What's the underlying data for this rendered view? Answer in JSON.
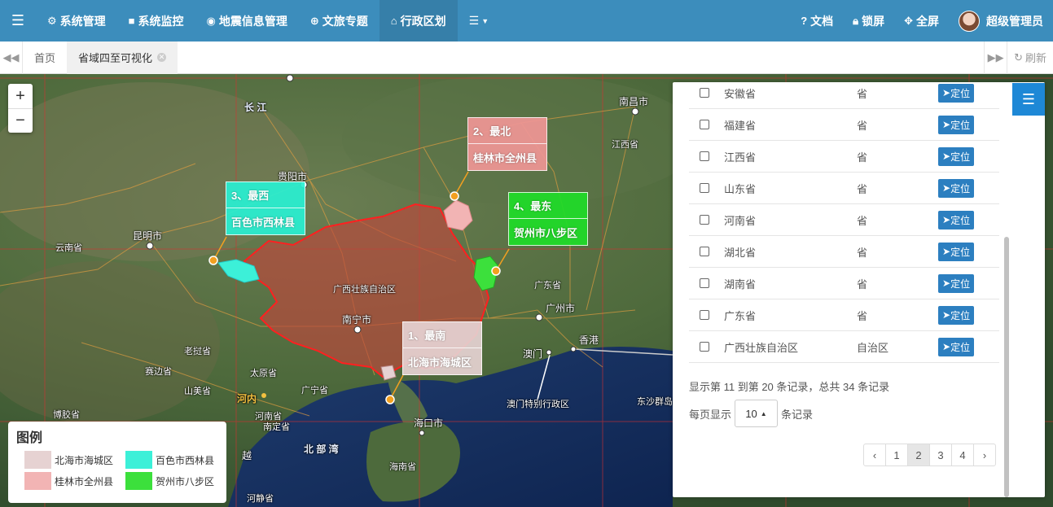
{
  "nav": {
    "items": [
      {
        "label": "系统管理",
        "icon": "gear-icon"
      },
      {
        "label": "系统监控",
        "icon": "video-icon"
      },
      {
        "label": "地震信息管理",
        "icon": "map-pin-icon"
      },
      {
        "label": "文旅专题",
        "icon": "globe-icon"
      },
      {
        "label": "行政区划",
        "icon": "bank-icon"
      }
    ],
    "active_index": 4,
    "right": {
      "docs": "文档",
      "lock": "锁屏",
      "fullscreen": "全屏",
      "user": "超级管理员"
    }
  },
  "tabs": {
    "home": "首页",
    "current": "省域四至可视化",
    "refresh": "刷新"
  },
  "map": {
    "callouts": {
      "south": {
        "title": "1、最南",
        "place": "北海市海城区",
        "color": "#e6d2d2"
      },
      "north": {
        "title": "2、最北",
        "place": "桂林市全州县",
        "color": "#f09696"
      },
      "west": {
        "title": "3、最西",
        "place": "百色市西林县",
        "color": "#28f0d2"
      },
      "east": {
        "title": "4、最东",
        "place": "贺州市八步区",
        "color": "#1edc28"
      }
    },
    "labels": {
      "region": "广西壮族自治区",
      "nanning": "南宁市",
      "kunming": "昆明市",
      "guiyang": "贵阳市",
      "nanchang": "南昌市",
      "guangzhou": "广州市",
      "hongkong": "香港",
      "macau": "澳门",
      "macau_sar": "澳门特别行政区",
      "haikou": "海口市",
      "yunnan": "云南省",
      "laos": "老挝省",
      "saiwan": "赛边省",
      "taiyuan": "太原省",
      "guangning": "广宁省",
      "shanmei": "山美省",
      "henei": "河内",
      "henan_vn": "河南省",
      "nanding": "南定省",
      "hainan": "海南省",
      "guangdong": "广东省",
      "jiangxi": "江西省",
      "beibu": "北 部 湾",
      "yue": "越",
      "hejiao": "河静省",
      "bojiao": "博胶省",
      "dongsha": "东沙群岛",
      "changjiang": "长  江"
    },
    "legend": {
      "title": "图例",
      "items": [
        {
          "label": "北海市海城区",
          "color": "#e6d2d2"
        },
        {
          "label": "百色市西林县",
          "color": "#3cf0d8"
        },
        {
          "label": "桂林市全州县",
          "color": "#f2b4b4"
        },
        {
          "label": "贺州市八步区",
          "color": "#3ce03c"
        }
      ]
    }
  },
  "panel": {
    "rows": [
      {
        "name": "安徽省",
        "level": "省",
        "action": "定位"
      },
      {
        "name": "福建省",
        "level": "省",
        "action": "定位"
      },
      {
        "name": "江西省",
        "level": "省",
        "action": "定位"
      },
      {
        "name": "山东省",
        "level": "省",
        "action": "定位"
      },
      {
        "name": "河南省",
        "level": "省",
        "action": "定位"
      },
      {
        "name": "湖北省",
        "level": "省",
        "action": "定位"
      },
      {
        "name": "湖南省",
        "level": "省",
        "action": "定位"
      },
      {
        "name": "广东省",
        "level": "省",
        "action": "定位"
      },
      {
        "name": "广西壮族自治区",
        "level": "自治区",
        "action": "定位"
      }
    ],
    "summary": "显示第 11 到第 20 条记录，总共 34 条记录",
    "page_size_prefix": "每页显示",
    "page_size": "10",
    "page_size_suffix": "条记录",
    "pager": [
      "‹",
      "1",
      "2",
      "3",
      "4",
      "›"
    ],
    "current_page": "2"
  }
}
